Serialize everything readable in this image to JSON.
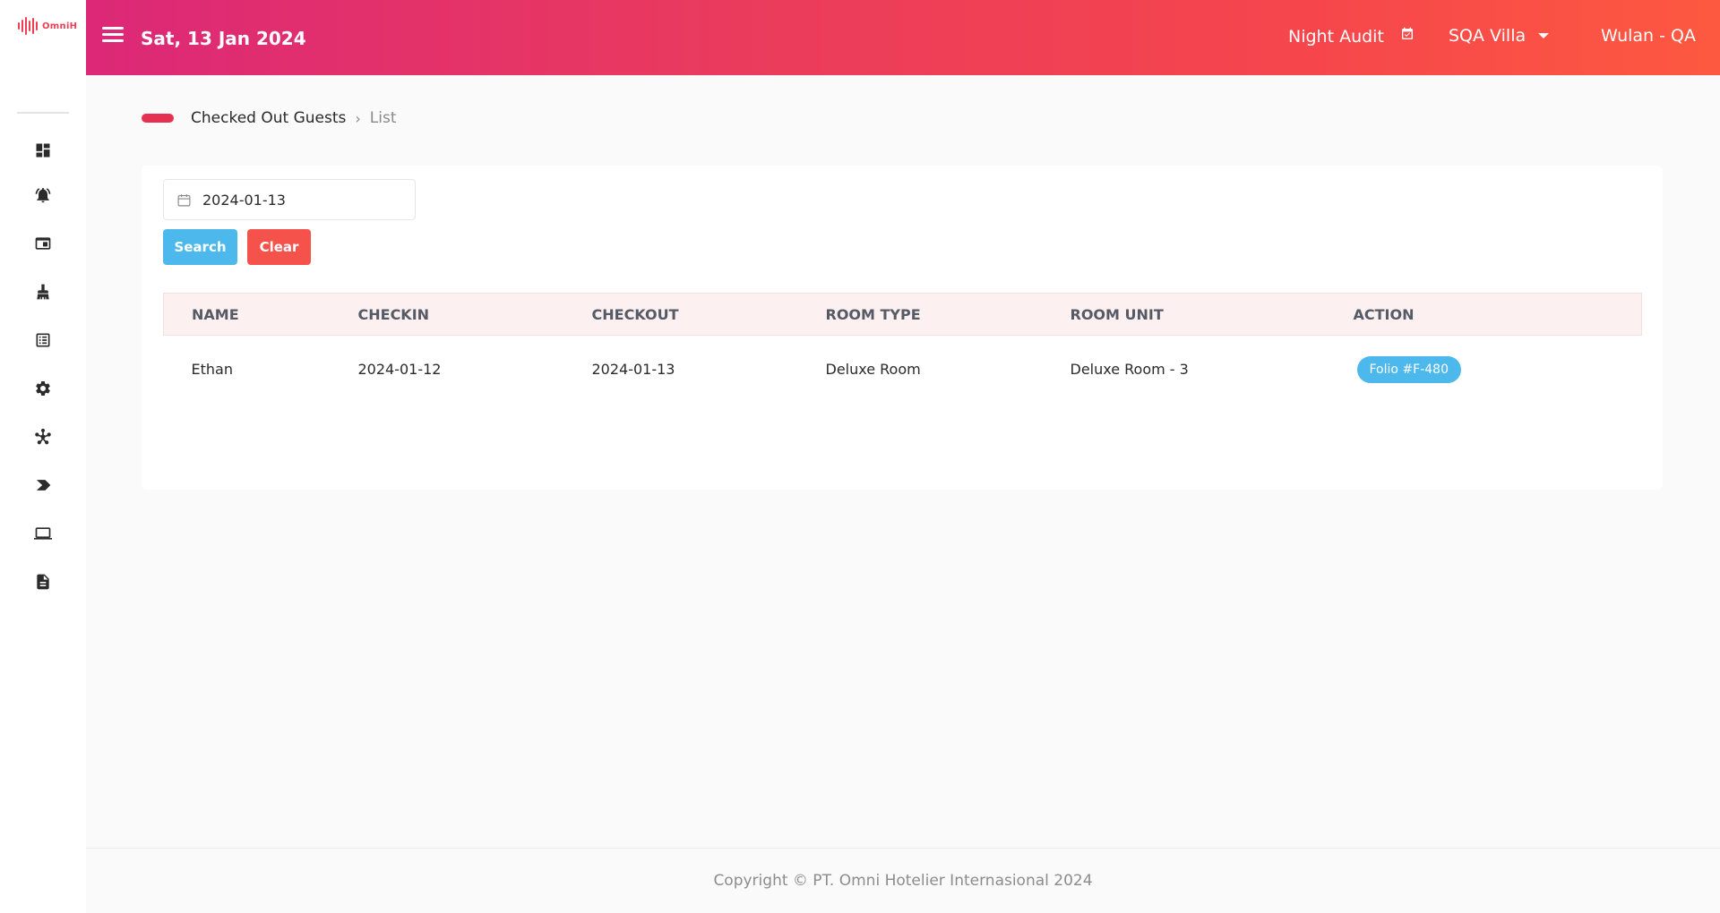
{
  "app": {
    "logo_text": "OmniH",
    "brand_color": "#ef3e54"
  },
  "header": {
    "date": "Sat, 13 Jan 2024",
    "night_audit_label": "Night Audit",
    "hotel": "SQA Villa",
    "user": "Wulan - QA",
    "gradient": [
      "#dc2877",
      "#fd5940"
    ]
  },
  "sidebar": {
    "items": [
      {
        "icon": "dashboard-icon"
      },
      {
        "icon": "bell-icon"
      },
      {
        "icon": "window-icon"
      },
      {
        "icon": "broom-icon"
      },
      {
        "icon": "list-icon"
      },
      {
        "icon": "gear-icon"
      },
      {
        "icon": "network-icon"
      },
      {
        "icon": "label-icon"
      },
      {
        "icon": "laptop-icon"
      },
      {
        "icon": "document-icon"
      }
    ]
  },
  "breadcrumb": {
    "section": "Checked Out Guests",
    "current": "List"
  },
  "filter": {
    "date_value": "2024-01-13",
    "search_label": "Search",
    "clear_label": "Clear"
  },
  "table": {
    "columns": [
      "NAME",
      "CHECKIN",
      "CHECKOUT",
      "ROOM TYPE",
      "ROOM UNIT",
      "ACTION"
    ],
    "rows": [
      {
        "name": "Ethan",
        "checkin": "2024-01-12",
        "checkout": "2024-01-13",
        "room_type": "Deluxe Room",
        "room_unit": "Deluxe Room - 3",
        "action": "Folio #F-480"
      }
    ]
  },
  "footer": {
    "copyright": "Copyright © PT. Omni Hotelier Internasional 2024"
  }
}
